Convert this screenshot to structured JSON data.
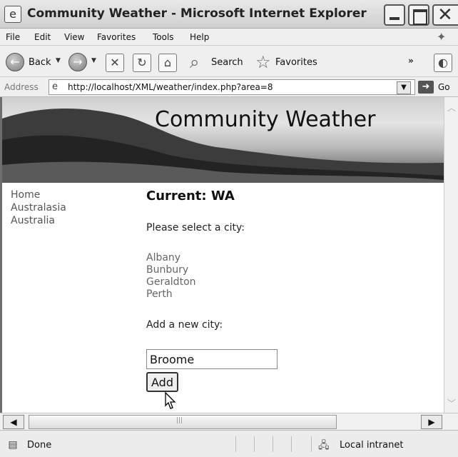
{
  "window": {
    "title": "Community Weather - Microsoft Internet Explorer",
    "app_icon": "ie-page-icon",
    "controls": [
      "minimize-icon",
      "maximize-icon",
      "close-icon"
    ]
  },
  "menubar": {
    "items": [
      "File",
      "Edit",
      "View",
      "Favorites",
      "Tools",
      "Help"
    ]
  },
  "toolbar": {
    "back_label": "Back",
    "search_label": "Search",
    "favorites_label": "Favorites",
    "more": "»"
  },
  "addressbar": {
    "label": "Address",
    "url": "http://localhost/XML/weather/index.php?area=8",
    "go_label": "Go"
  },
  "page": {
    "banner_title": "Community Weather",
    "nav": [
      "Home",
      "Australasia",
      "Australia"
    ],
    "heading": "Current: WA",
    "select_prompt": "Please select a city:",
    "cities": [
      "Albany",
      "Bunbury",
      "Geraldton",
      "Perth"
    ],
    "add_prompt": "Add a new city:",
    "new_city_value": "Broome",
    "add_button_label": "Add"
  },
  "statusbar": {
    "status_text": "Done",
    "zone_text": "Local intranet"
  }
}
